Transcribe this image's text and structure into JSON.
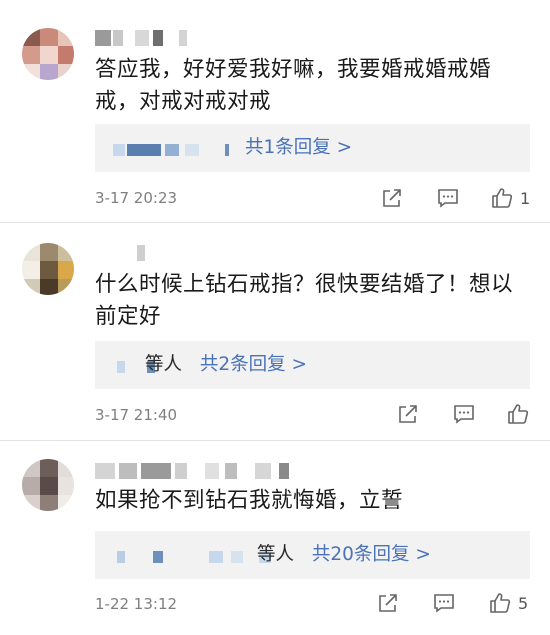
{
  "comments": [
    {
      "text_line1": "答应我，好好爱我好嘛，我要婚戒婚戒婚",
      "text_line2": "戒，对戒对戒对戒",
      "reply_prefix": "",
      "reply_label": "共1条回复 >",
      "time": "3-17 20:23",
      "likes": "1"
    },
    {
      "text_line1": "什么时候上钻石戒指？很快要结婚了！想以",
      "text_line2": "前定好",
      "reply_prefix": "等人",
      "reply_label": "共2条回复 >",
      "time": "3-17 21:40",
      "likes": ""
    },
    {
      "text_line1": "如果抢不到钻石我就悔婚，立誓",
      "text_line2": "",
      "reply_prefix": "等人",
      "reply_label": "共20条回复 >",
      "time": "1-22 13:12",
      "likes": "5"
    }
  ],
  "icons": {
    "forward": "share-forward-icon",
    "comment": "comment-bubble-icon",
    "like": "thumbs-up-icon"
  },
  "colors": {
    "link": "#4a72b8",
    "meta": "#7f7f7f",
    "reply_bg": "#f2f2f2"
  }
}
